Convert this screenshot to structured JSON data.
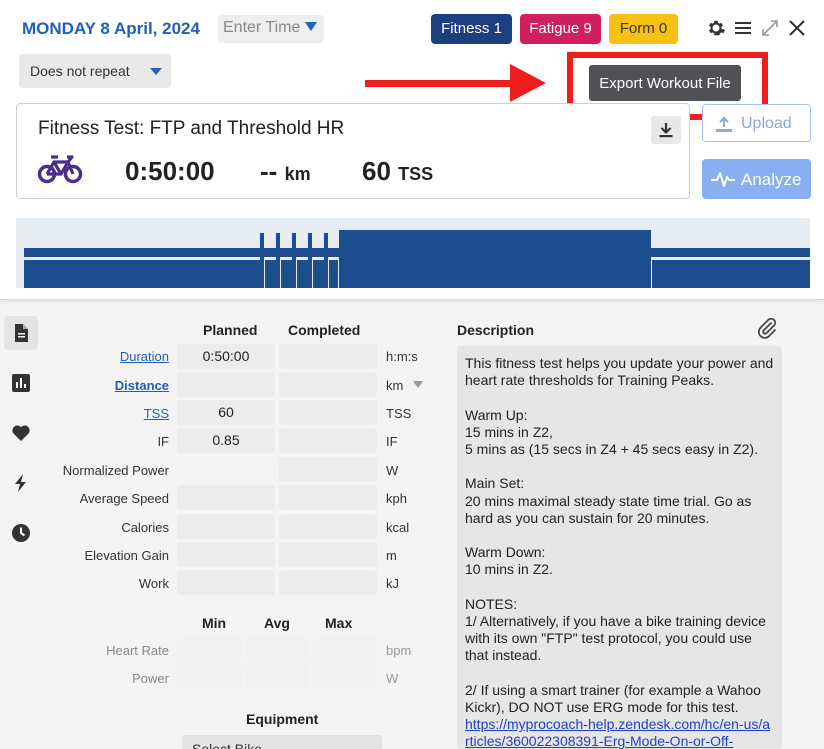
{
  "header": {
    "date": "MONDAY 8 April, 2024",
    "time_placeholder": "Enter Time",
    "fitness_label": "Fitness 1",
    "fatigue_label": "Fatigue 9",
    "form_label": "Form 0",
    "repeat_value": "Does not repeat",
    "tooltip": "Export Workout File",
    "colors": {
      "fitness": "#1c3f82",
      "fatigue": "#d01f5e",
      "form": "#f7c114",
      "accent": "#1f5fbf",
      "annotation": "#ef1d1d"
    }
  },
  "workout": {
    "title": "Fitness Test: FTP and Threshold HR",
    "sport_icon": "bike-icon",
    "duration": "0:50:00",
    "distance_value": "--",
    "distance_unit": "km",
    "tss_value": "60",
    "tss_unit": "TSS"
  },
  "actions": {
    "upload_label": "Upload",
    "analyze_label": "Analyze"
  },
  "sidebar": {
    "items": [
      "file-icon",
      "chart-icon",
      "heart-icon",
      "bolt-icon",
      "clock-icon"
    ]
  },
  "metrics": {
    "planned_header": "Planned",
    "completed_header": "Completed",
    "rows": [
      {
        "label": "Duration",
        "planned": "0:50:00",
        "completed": "",
        "unit": "h:m:s"
      },
      {
        "label": "Distance",
        "planned": "",
        "completed": "",
        "unit": "km"
      },
      {
        "label": "TSS",
        "planned": "60",
        "completed": "",
        "unit": "TSS"
      },
      {
        "label": "IF",
        "planned": "0.85",
        "completed": "",
        "unit": "IF"
      },
      {
        "label": "Normalized Power",
        "planned": "",
        "completed": "",
        "unit": "W"
      },
      {
        "label": "Average Speed",
        "planned": "",
        "completed": "",
        "unit": "kph"
      },
      {
        "label": "Calories",
        "planned": "",
        "completed": "",
        "unit": "kcal"
      },
      {
        "label": "Elevation Gain",
        "planned": "",
        "completed": "",
        "unit": "m"
      },
      {
        "label": "Work",
        "planned": "",
        "completed": "",
        "unit": "kJ"
      }
    ],
    "range_headers": [
      "Min",
      "Avg",
      "Max"
    ],
    "range_rows": [
      {
        "label": "Heart Rate",
        "unit": "bpm"
      },
      {
        "label": "Power",
        "unit": "W"
      }
    ],
    "equipment_title": "Equipment",
    "equipment_value": "Select Bike"
  },
  "description": {
    "title": "Description",
    "text": "This fitness test helps you update your power and heart rate thresholds for Training Peaks.\n\nWarm Up:\n15 mins in Z2,\n5 mins as (15 secs in Z4 + 45 secs easy in Z2).\n\nMain Set:\n20 mins maximal steady state time trial. Go as hard as you can sustain for 20 minutes.\n\nWarm Down:\n10 mins in Z2.\n\nNOTES:\n1/ Alternatively, if you have a bike training device with its own \"FTP\" test protocol, you could use that instead.\n\n2/ If using a smart trainer (for example a Wahoo Kickr), DO NOT use ERG mode for this test.",
    "link": "https://myprocoach-help.zendesk.com/hc/en-us/articles/360022308391-Erg-Mode-On-or-Off-"
  }
}
